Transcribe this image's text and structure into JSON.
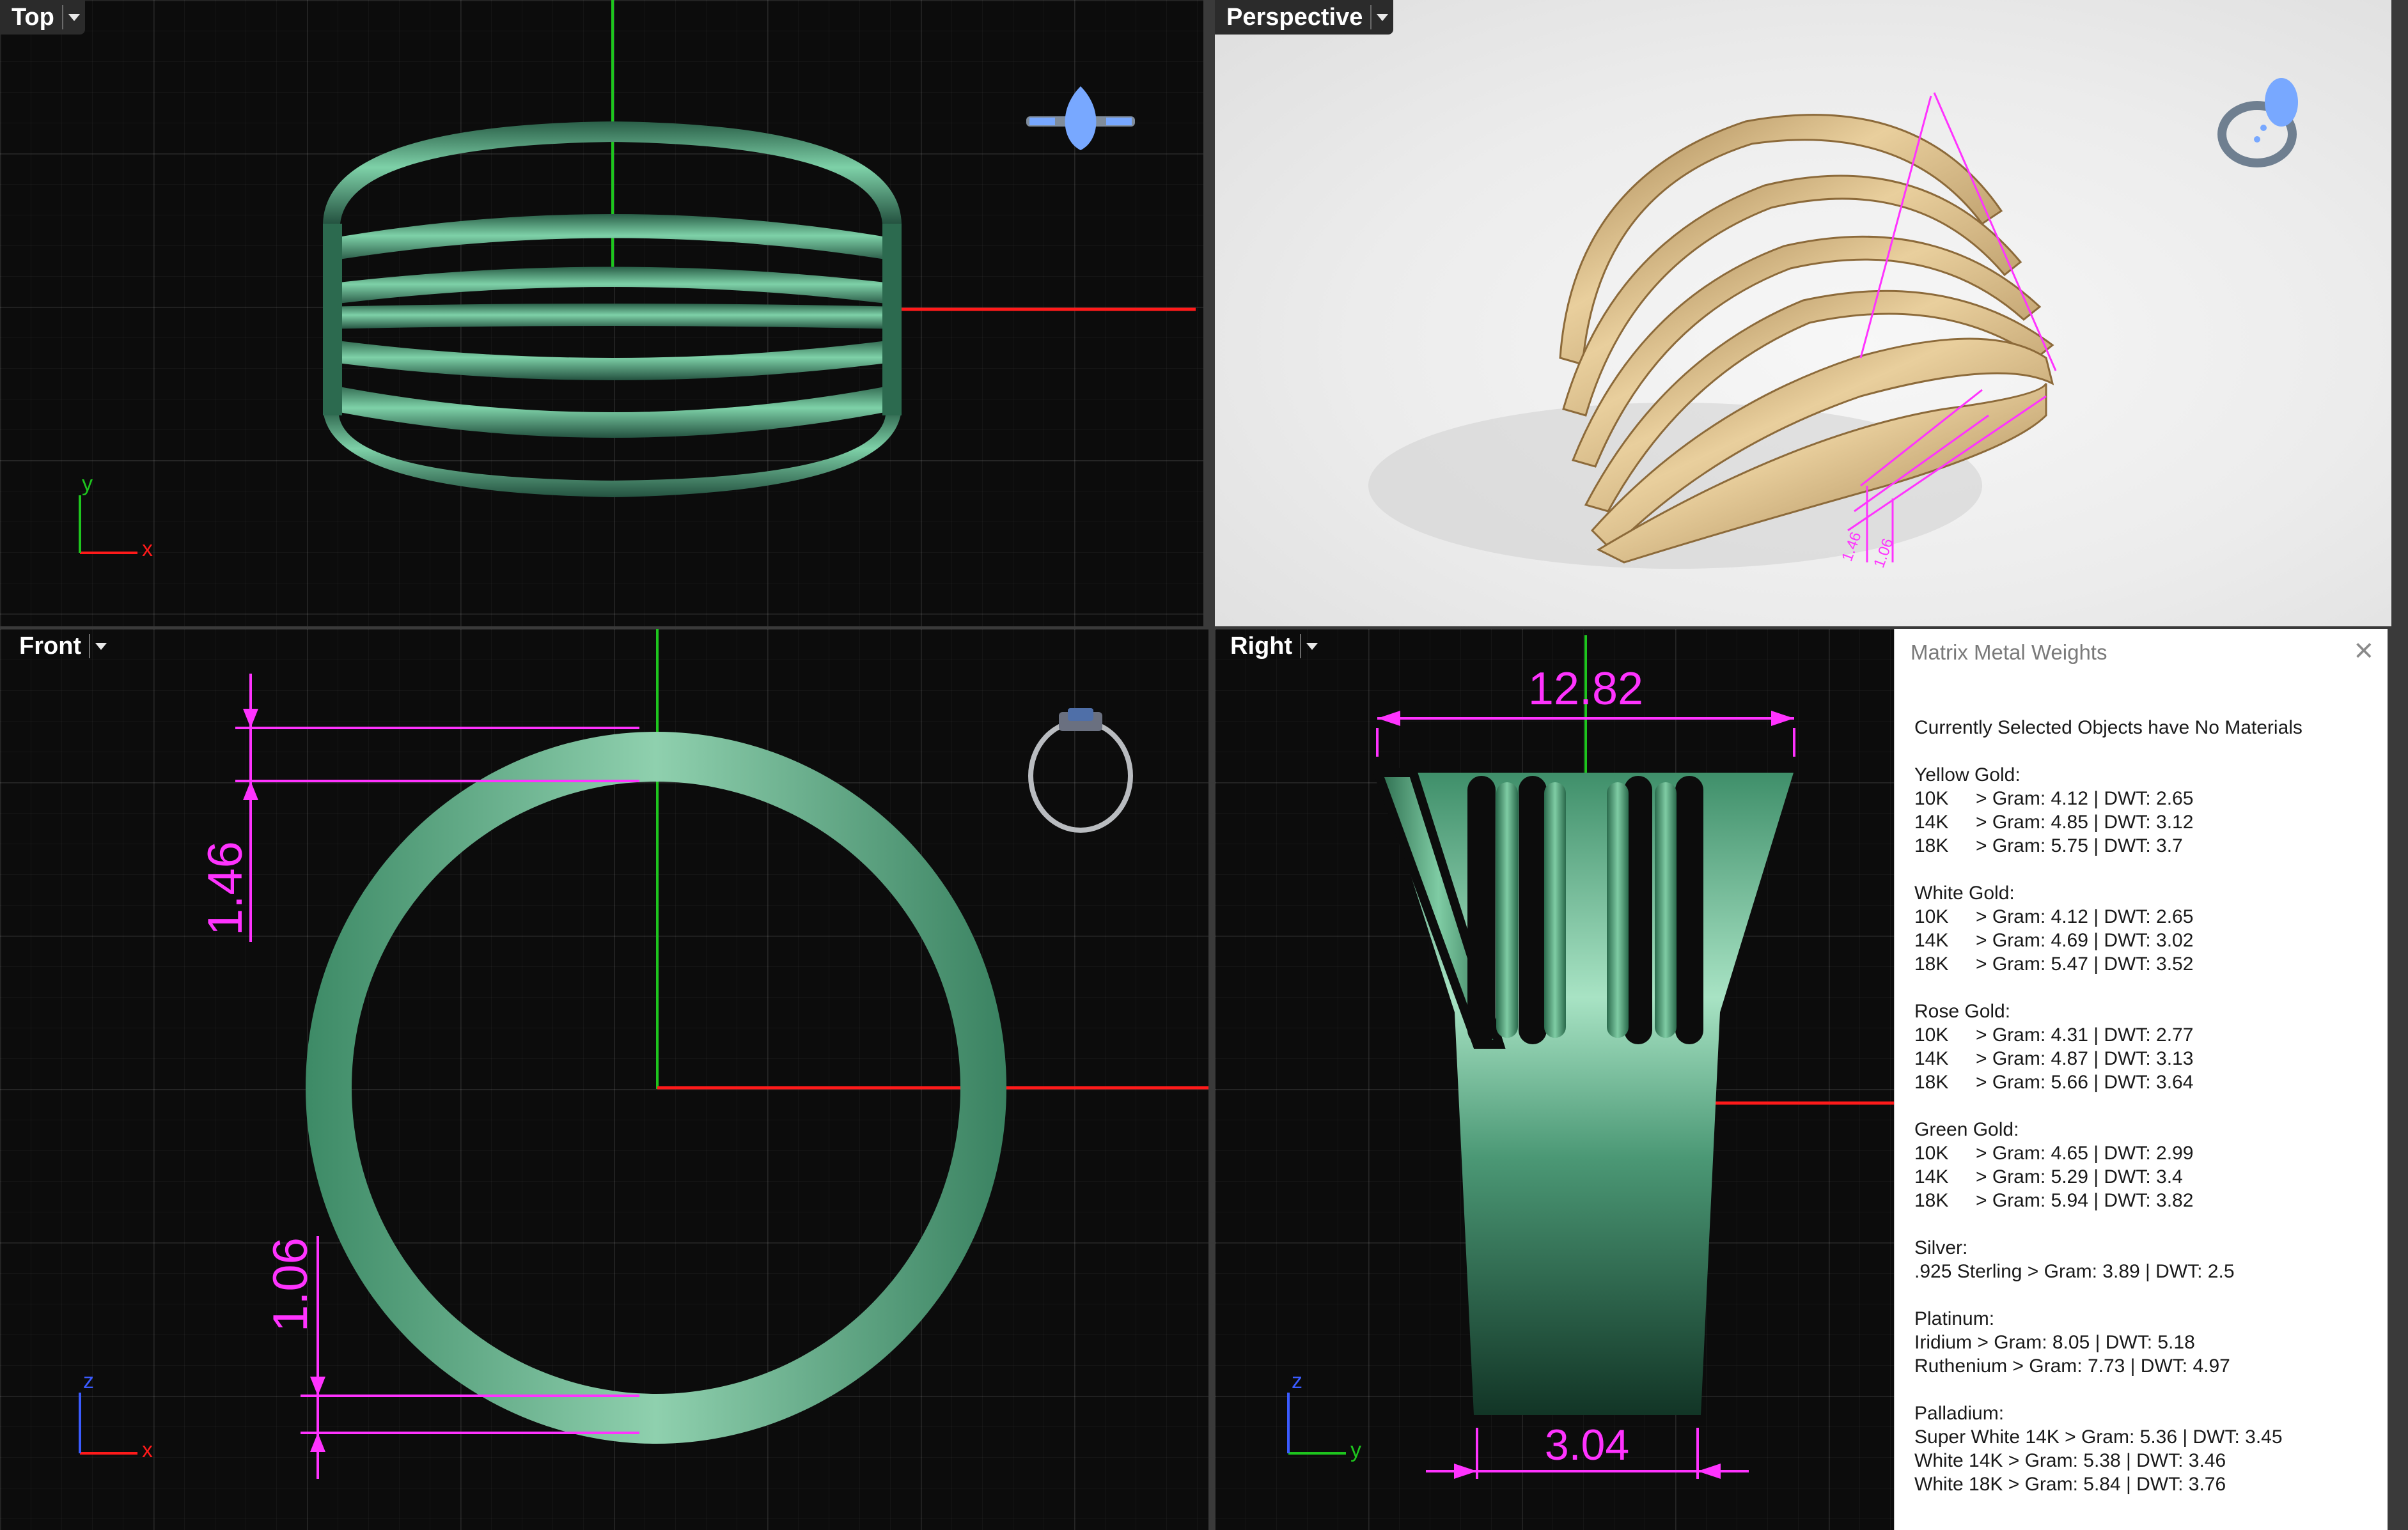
{
  "viewports": {
    "top": {
      "label": "Top",
      "axis_x": "x",
      "axis_y": "y"
    },
    "perspective": {
      "label": "Perspective"
    },
    "front": {
      "label": "Front",
      "axis_x": "x",
      "axis_y": "z",
      "dim_top": "1.46",
      "dim_bottom": "1.06"
    },
    "right": {
      "label": "Right",
      "axis_x": "y",
      "axis_y": "z",
      "dim_top": "12.82",
      "dim_bottom": "3.04"
    }
  },
  "panel": {
    "title": "Matrix Metal Weights",
    "status": "Currently Selected Objects have No Materials",
    "groups": [
      {
        "name": "Yellow Gold:",
        "rows": [
          {
            "karat": "10K",
            "value": "> Gram: 4.12 | DWT: 2.65"
          },
          {
            "karat": "14K",
            "value": "> Gram: 4.85 | DWT: 3.12"
          },
          {
            "karat": "18K",
            "value": "> Gram: 5.75 | DWT: 3.7"
          }
        ]
      },
      {
        "name": "White Gold:",
        "rows": [
          {
            "karat": "10K",
            "value": "> Gram: 4.12 | DWT: 2.65"
          },
          {
            "karat": "14K",
            "value": "> Gram: 4.69 | DWT: 3.02"
          },
          {
            "karat": "18K",
            "value": "> Gram: 5.47 | DWT: 3.52"
          }
        ]
      },
      {
        "name": "Rose Gold:",
        "rows": [
          {
            "karat": "10K",
            "value": "> Gram: 4.31 | DWT: 2.77"
          },
          {
            "karat": "14K",
            "value": "> Gram: 4.87 | DWT: 3.13"
          },
          {
            "karat": "18K",
            "value": "> Gram: 5.66 | DWT: 3.64"
          }
        ]
      },
      {
        "name": "Green Gold:",
        "rows": [
          {
            "karat": "10K",
            "value": "> Gram: 4.65 | DWT: 2.99"
          },
          {
            "karat": "14K",
            "value": "> Gram: 5.29 | DWT: 3.4"
          },
          {
            "karat": "18K",
            "value": "> Gram: 5.94 | DWT: 3.82"
          }
        ]
      }
    ],
    "silver": {
      "name": "Silver:",
      "line1": ".925 Sterling > Gram: 3.89 | DWT: 2.5"
    },
    "platinum": {
      "name": "Platinum:",
      "line1": "Iridium > Gram: 8.05 | DWT: 5.18",
      "line2": "Ruthenium > Gram: 7.73 | DWT: 4.97"
    },
    "palladium": {
      "name": "Palladium:",
      "line1": "Super White 14K > Gram: 5.36 | DWT: 3.45",
      "line2": "White 14K > Gram: 5.38 | DWT: 3.46",
      "line3": "White 18K > Gram: 5.84 | DWT: 3.76"
    }
  },
  "colors": {
    "model_green": "#4f9a78",
    "model_gold": "#d2b07c",
    "dimension": "#ff33ff",
    "axis_x": "#ff1a1a",
    "axis_y": "#1ec51e",
    "gem": "#78a8ff"
  }
}
